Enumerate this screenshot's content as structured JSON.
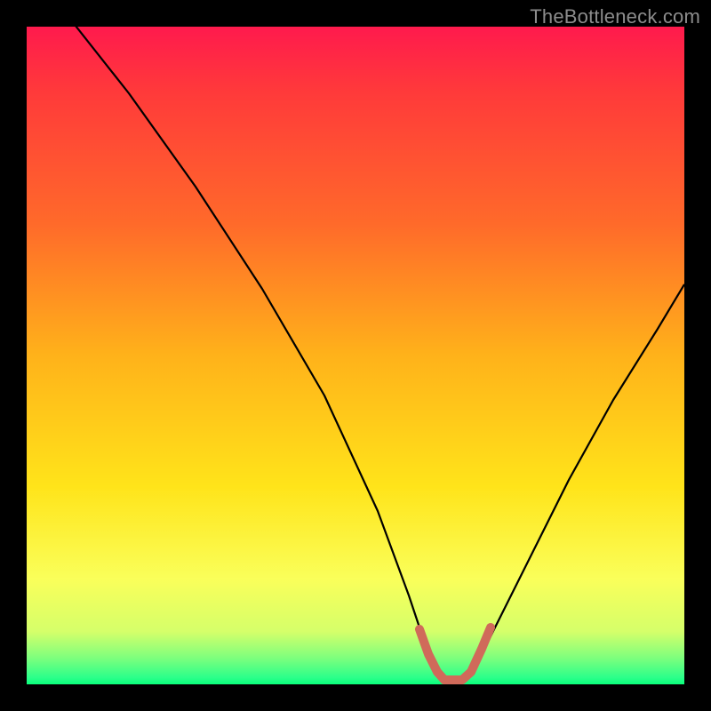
{
  "watermark": {
    "text": "TheBottleneck.com"
  },
  "colors": {
    "background": "#000000",
    "gradient_top": "#ff1a4d",
    "gradient_mid1": "#ff6a2a",
    "gradient_mid2": "#ffe41a",
    "gradient_bottom": "#0aff7b",
    "curve": "#000000",
    "highlight": "#d06a5a"
  },
  "chart_data": {
    "type": "line",
    "title": "",
    "xlabel": "",
    "ylabel": "",
    "xlim": [
      0,
      100
    ],
    "ylim": [
      0,
      100
    ],
    "series": [
      {
        "name": "bottleneck-curve",
        "x": [
          0,
          5,
          10,
          15,
          20,
          25,
          30,
          35,
          40,
          45,
          50,
          55,
          57,
          60,
          63,
          65,
          70,
          75,
          80,
          85,
          90,
          95,
          100
        ],
        "values": [
          105,
          98,
          91,
          83,
          75,
          67,
          58,
          49,
          40,
          31,
          21,
          10,
          4,
          0,
          0,
          3,
          12,
          22,
          31,
          40,
          49,
          57,
          65
        ]
      }
    ],
    "highlight_range": {
      "x_start": 56,
      "x_end": 66
    },
    "annotations": []
  }
}
